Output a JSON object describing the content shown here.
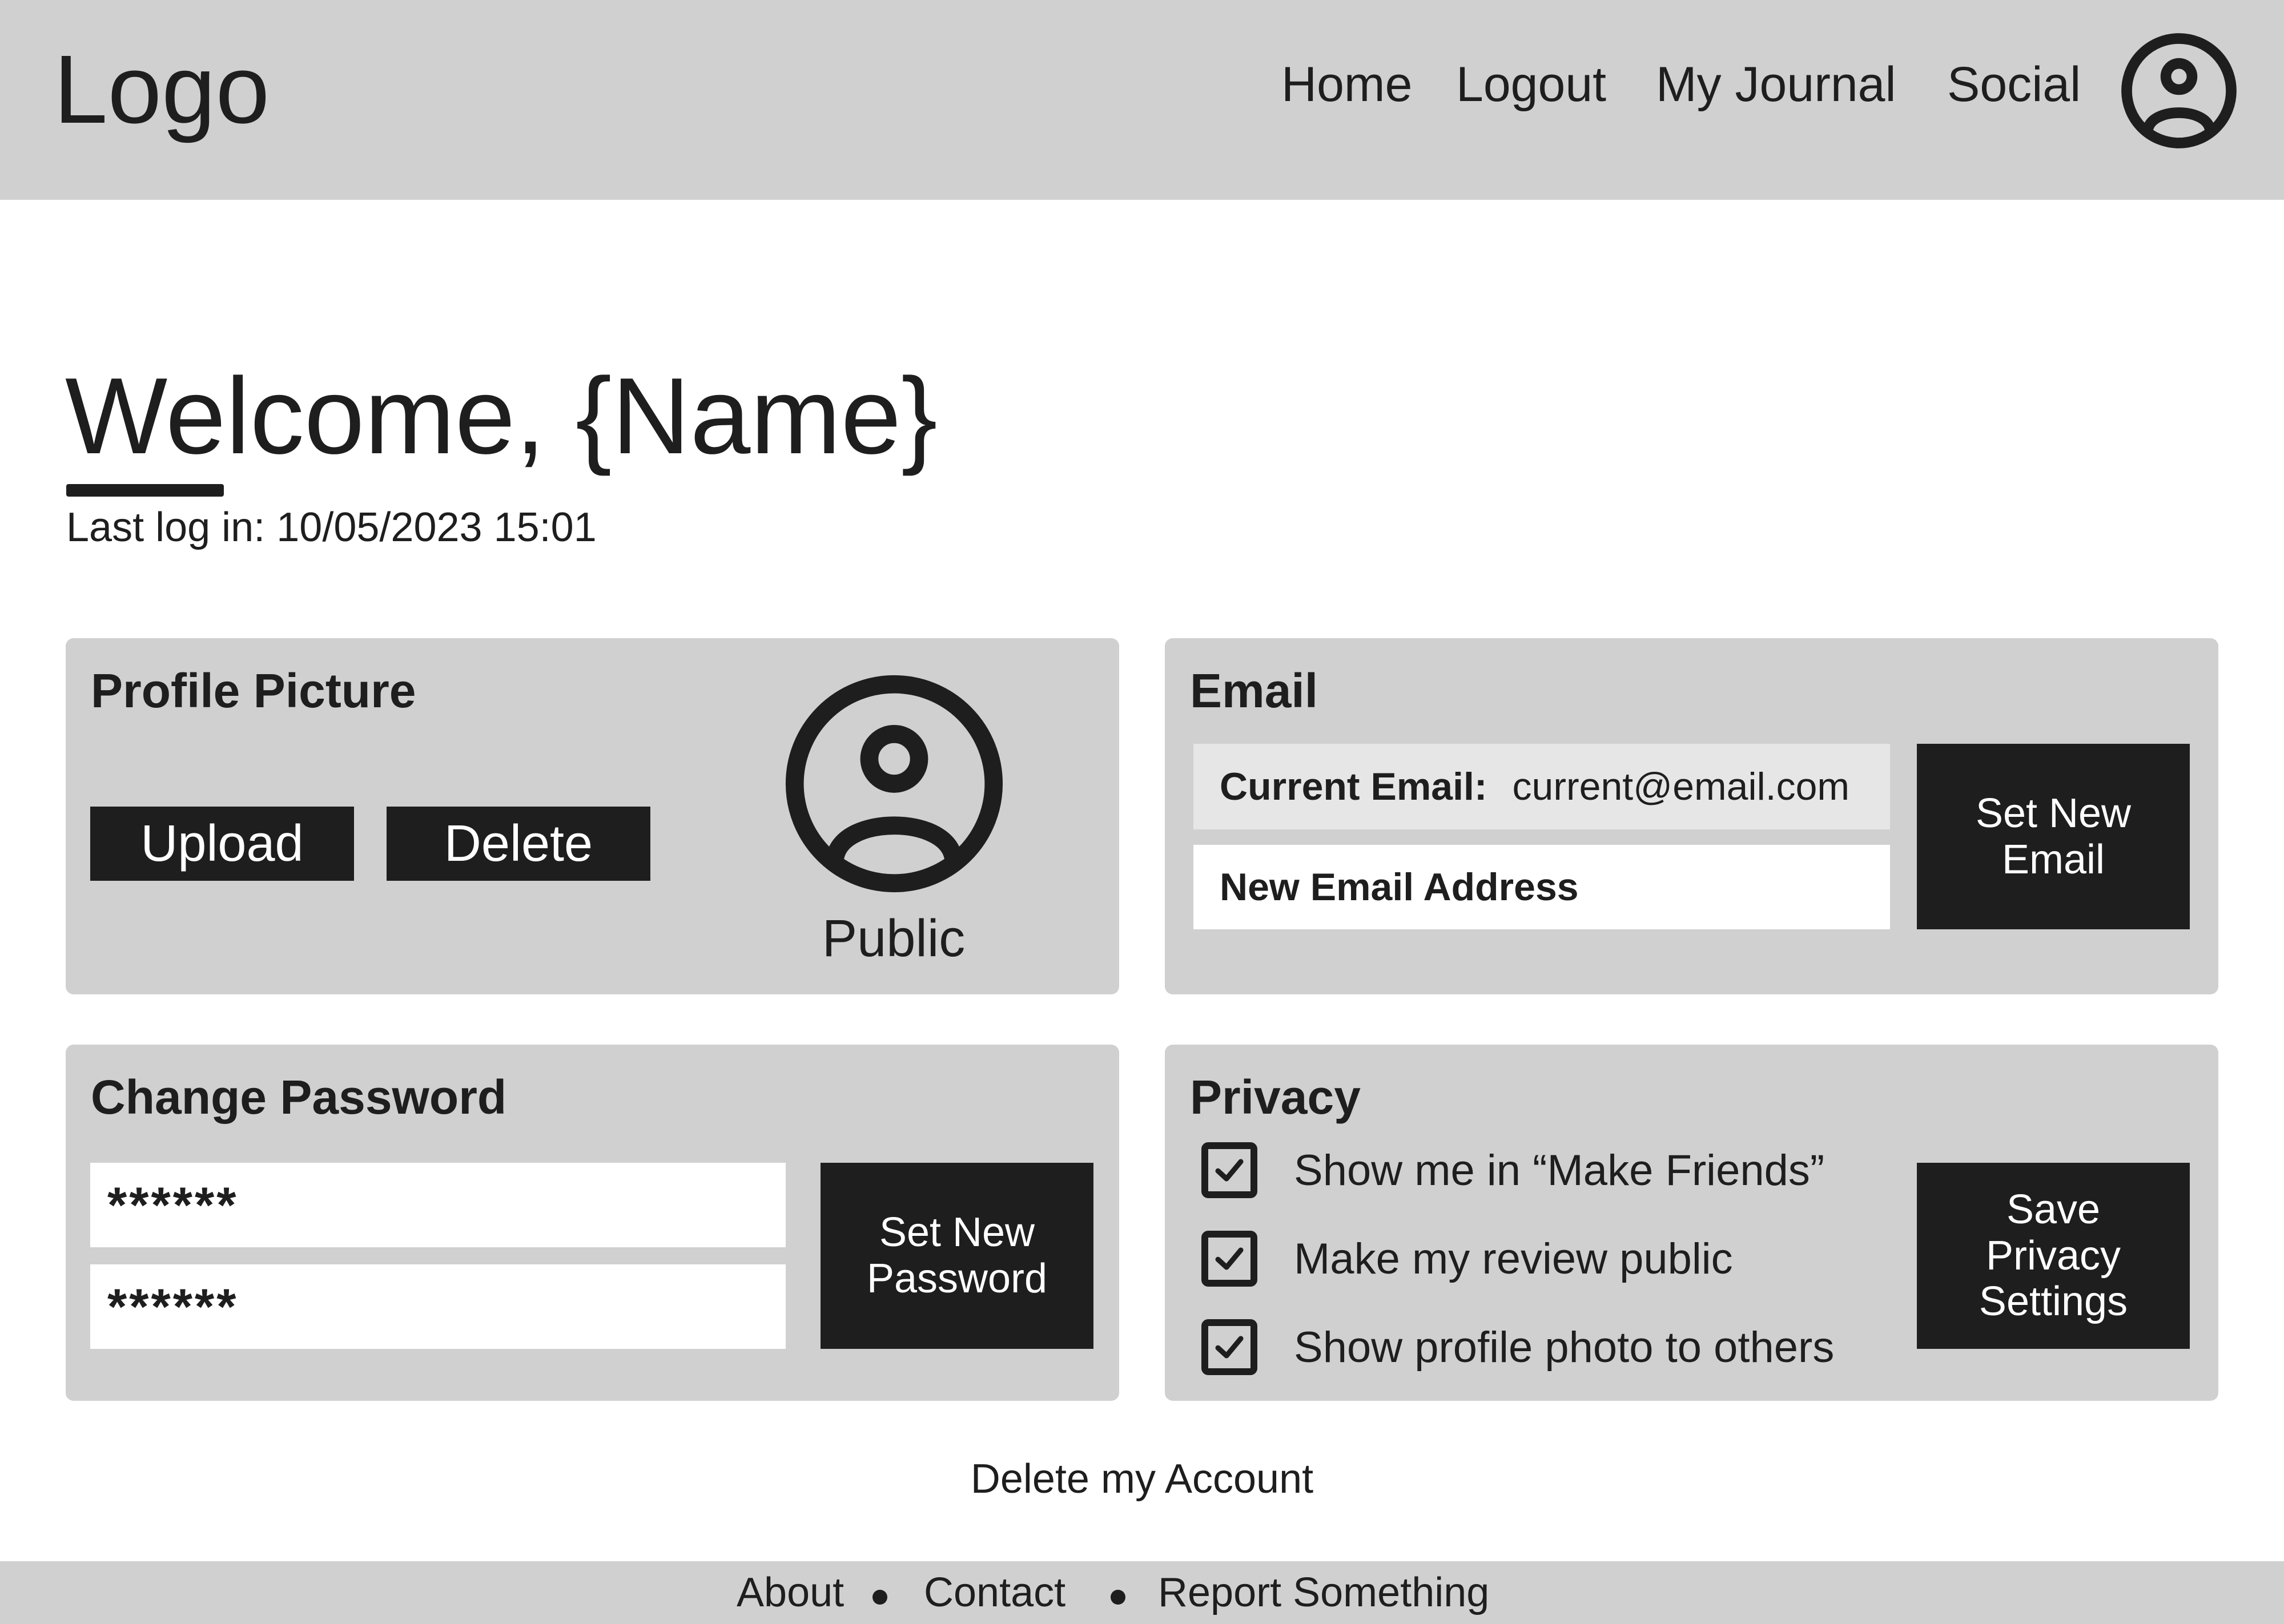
{
  "header": {
    "logo": "Logo",
    "nav": [
      "Home",
      "Logout",
      "My Journal",
      "Social"
    ],
    "avatar_icon": "user-circle-icon"
  },
  "welcome": {
    "title": "Welcome, {Name}",
    "last_login": "Last log in: 10/05/2023 15:01"
  },
  "profile_picture": {
    "title": "Profile Picture",
    "upload_label": "Upload",
    "delete_label": "Delete",
    "visibility": "Public",
    "avatar_icon": "user-circle-icon"
  },
  "email": {
    "title": "Email",
    "current_label": "Current Email:",
    "current_value": "current@email.com",
    "new_placeholder": "New Email Address",
    "set_button": "Set New Email"
  },
  "password": {
    "title": "Change Password",
    "field1_value": "******",
    "field2_value": "******",
    "set_button": "Set New Password"
  },
  "privacy": {
    "title": "Privacy",
    "options": [
      {
        "label": "Show me in “Make Friends”",
        "checked": true
      },
      {
        "label": "Make my review public",
        "checked": true
      },
      {
        "label": "Show profile photo to others",
        "checked": true
      }
    ],
    "save_button": "Save Privacy Settings"
  },
  "delete_account": "Delete my Account",
  "footer": {
    "links": [
      "About",
      "Contact",
      "Report Something"
    ]
  },
  "colors": {
    "panel": "#d0d0d0",
    "dark": "#1e1e1e",
    "field_readonly": "#e6e6e6",
    "background": "#ffffff"
  }
}
